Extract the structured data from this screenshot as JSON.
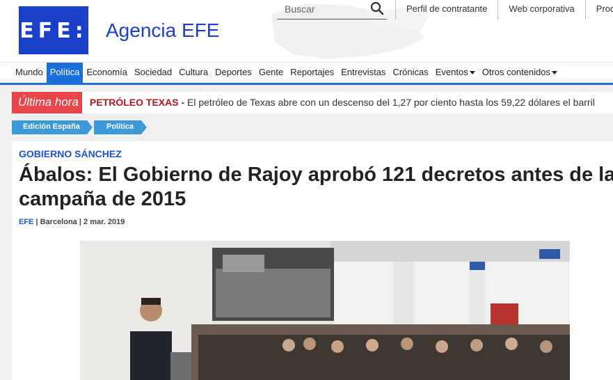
{
  "header": {
    "logo_text": "EFE:",
    "brand": "Agencia EFE",
    "search_placeholder": "Buscar",
    "top_links": [
      "Perfil de contratante",
      "Web corporativa",
      "Prod"
    ]
  },
  "nav": {
    "items": [
      "Mundo",
      "Política",
      "Economía",
      "Sociedad",
      "Cultura",
      "Deportes",
      "Gente",
      "Reportajes",
      "Entrevistas",
      "Crónicas",
      "Eventos",
      "Otros contenidos"
    ],
    "active": "Política",
    "accent_color": "#1a6fd8"
  },
  "breaking": {
    "label": "Última hora",
    "headline": "PETRÓLEO TEXAS -",
    "text": "El petróleo de Texas abre con un descenso del 1,27 por ciento hasta los 59,22 dólares el barril",
    "label_color": "#e8454b"
  },
  "breadcrumbs": [
    "Edición España",
    "Política"
  ],
  "article": {
    "kicker": "GOBIERNO SÁNCHEZ",
    "title": "Ábalos: El Gobierno de Rajoy aprobó 121 decretos antes de la campaña de 2015",
    "source": "EFE",
    "city": "Barcelona",
    "date": "2 mar. 2019"
  }
}
